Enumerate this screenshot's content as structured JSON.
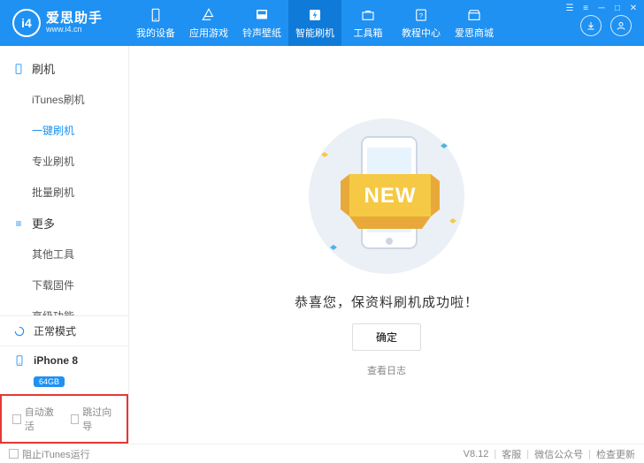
{
  "header": {
    "logo_text": "爱思助手",
    "logo_glyph": "i4",
    "logo_url": "www.i4.cn",
    "nav": [
      {
        "label": "我的设备",
        "icon": "device"
      },
      {
        "label": "应用游戏",
        "icon": "apps"
      },
      {
        "label": "铃声壁纸",
        "icon": "music"
      },
      {
        "label": "智能刷机",
        "icon": "flash"
      },
      {
        "label": "工具箱",
        "icon": "toolbox"
      },
      {
        "label": "教程中心",
        "icon": "help"
      },
      {
        "label": "爱思商城",
        "icon": "store"
      }
    ],
    "active_nav_index": 3
  },
  "sidebar": {
    "groups": [
      {
        "title": "刷机",
        "icon": "phone-outline",
        "items": [
          "iTunes刷机",
          "一键刷机",
          "专业刷机",
          "批量刷机"
        ],
        "active_index": 1
      },
      {
        "title": "更多",
        "icon": "menu-lines",
        "items": [
          "其他工具",
          "下载固件",
          "高级功能"
        ],
        "active_index": -1
      }
    ],
    "status_mode": "正常模式",
    "device_name": "iPhone 8",
    "device_badge": "64GB",
    "checkboxes": {
      "auto_activate": "自动激活",
      "skip_guide": "跳过向导"
    }
  },
  "main": {
    "illustration_new_label": "NEW",
    "success_message": "恭喜您，保资料刷机成功啦！",
    "ok_label": "确定",
    "log_link": "查看日志"
  },
  "footer": {
    "block_itunes": "阻止iTunes运行",
    "version": "V8.12",
    "support": "客服",
    "wechat": "微信公众号",
    "update": "检查更新"
  }
}
